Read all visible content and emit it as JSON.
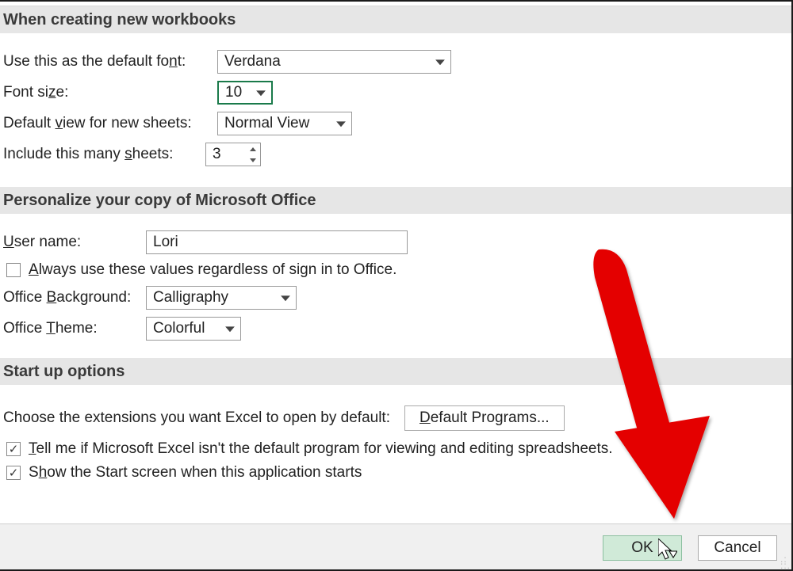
{
  "sections": {
    "workbooks": {
      "title": "When creating new workbooks",
      "font_label": "Use this as the default font:",
      "font_value": "Verdana",
      "size_label": "Font size:",
      "size_value": "10",
      "view_label": "Default view for new sheets:",
      "view_value": "Normal View",
      "sheets_label": "Include this many sheets:",
      "sheets_value": "3"
    },
    "personalize": {
      "title": "Personalize your copy of Microsoft Office",
      "username_label": "User name:",
      "username_value": "Lori",
      "always_label": "Always use these values regardless of sign in to Office.",
      "background_label": "Office Background:",
      "background_value": "Calligraphy",
      "theme_label": "Office Theme:",
      "theme_value": "Colorful"
    },
    "startup": {
      "title": "Start up options",
      "choose_label": "Choose the extensions you want Excel to open by default:",
      "default_programs_btn": "Default Programs...",
      "tellme_label": "Tell me if Microsoft Excel isn't the default program for viewing and editing spreadsheets.",
      "showstart_label": "Show the Start screen when this application starts"
    }
  },
  "footer": {
    "ok": "OK",
    "cancel": "Cancel"
  }
}
